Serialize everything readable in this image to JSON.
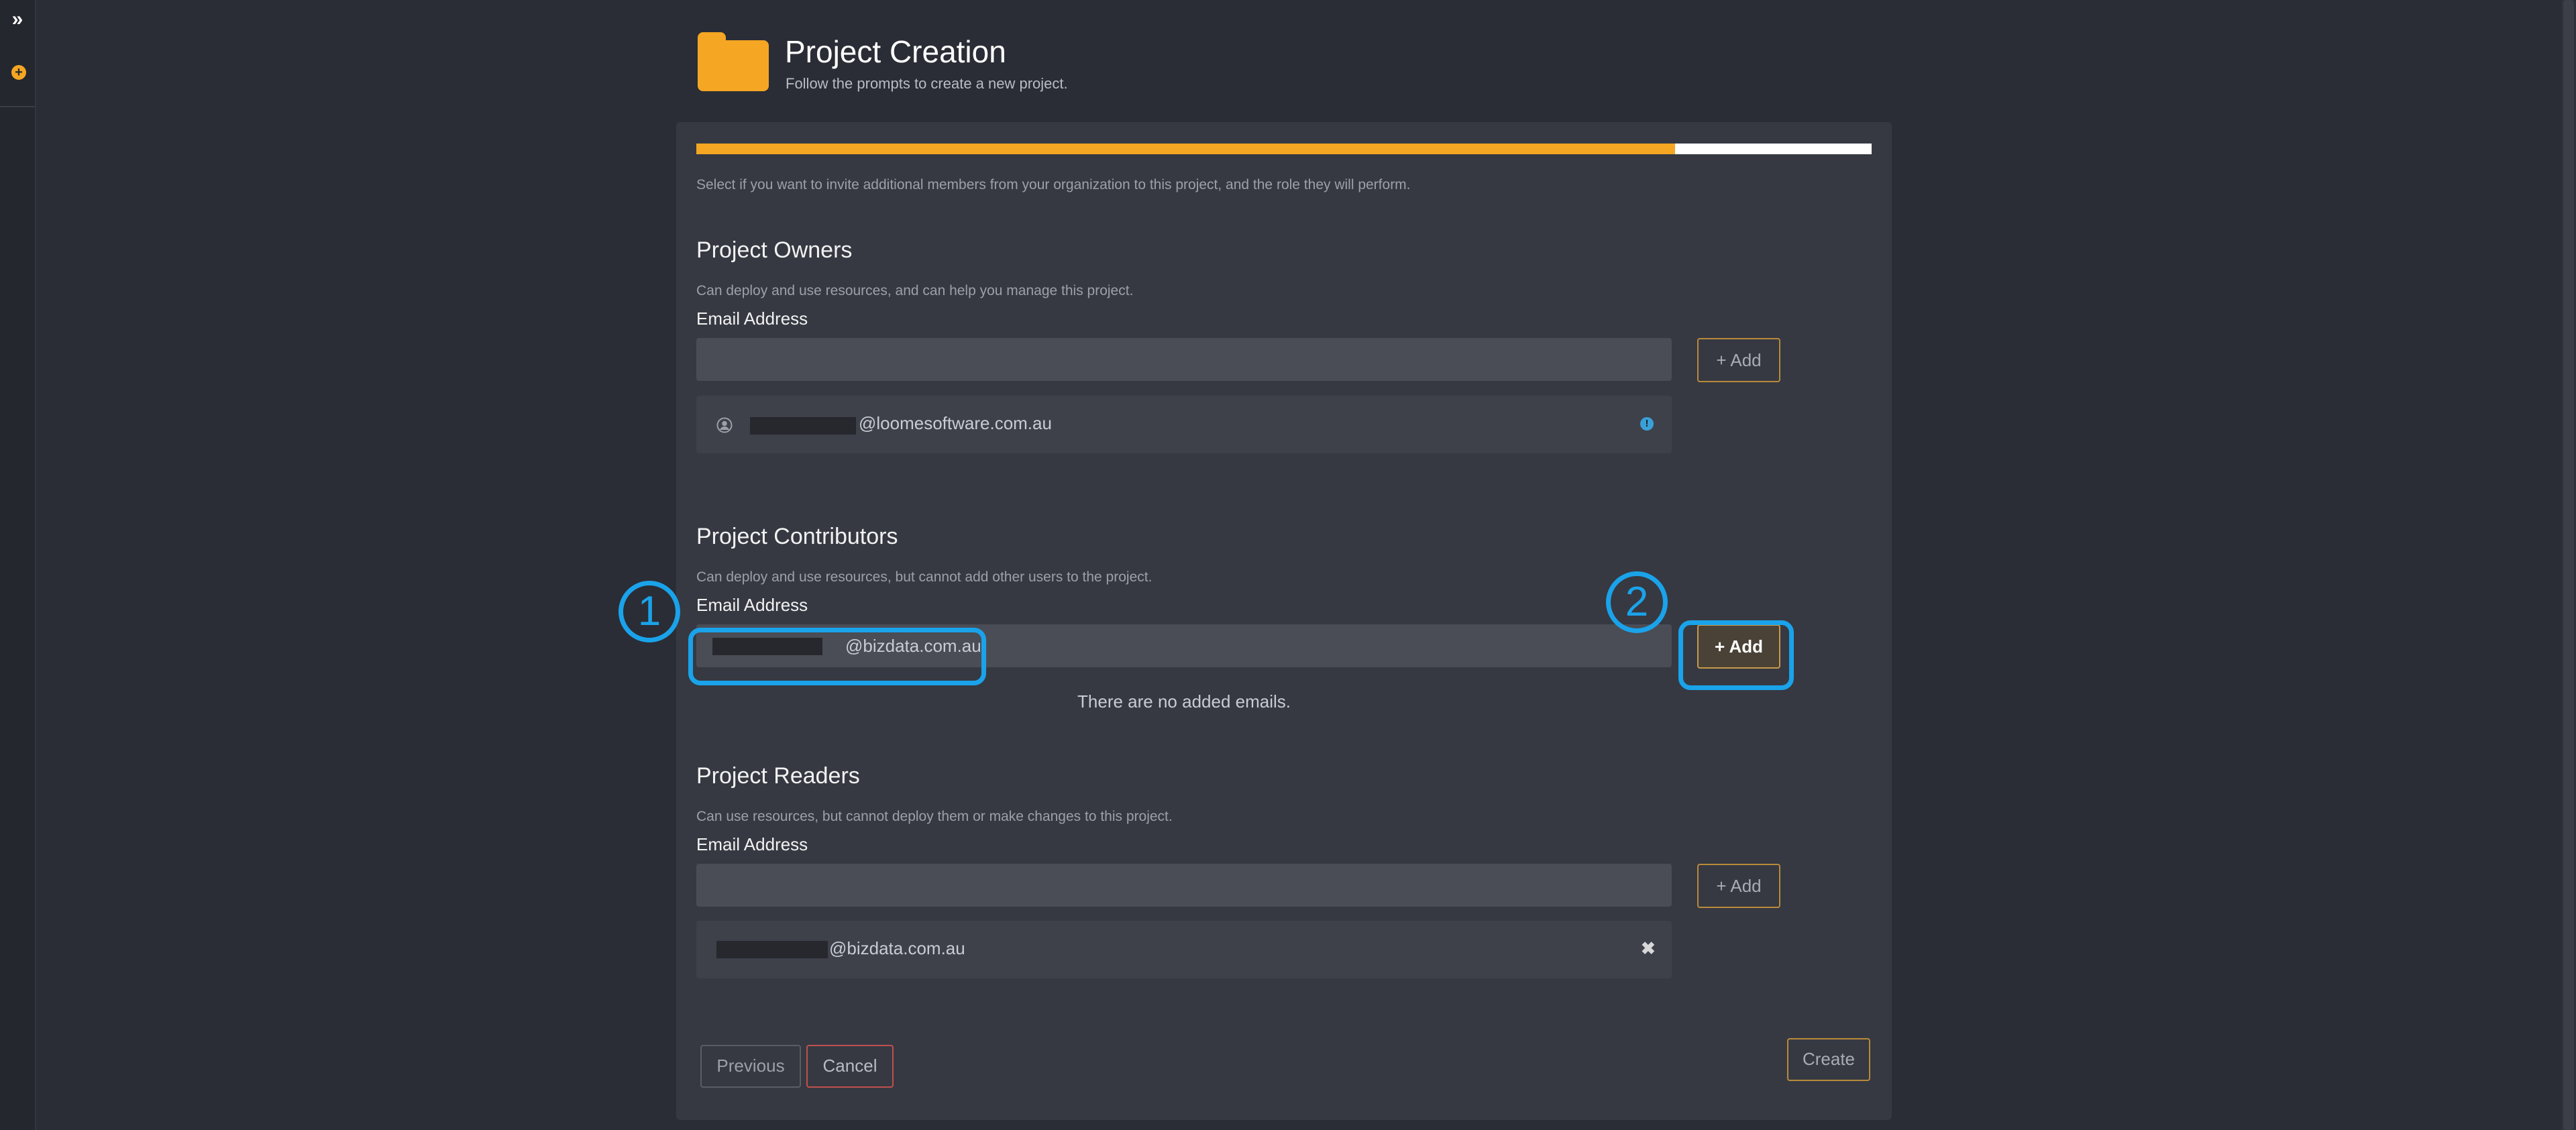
{
  "header": {
    "title": "Project Creation",
    "subtitle": "Follow the prompts to create a new project."
  },
  "progress": {
    "percent": 83.3
  },
  "intro": "Select if you want to invite additional members from your organization to this project, and the role they will perform.",
  "owners": {
    "title": "Project Owners",
    "description": "Can deploy and use resources, and can help you manage this project.",
    "label": "Email Address",
    "input_value": "",
    "add_label": "+ Add",
    "members": [
      {
        "email": "@loomesoftware.com.au"
      }
    ]
  },
  "contributors": {
    "title": "Project Contributors",
    "description": "Can deploy and use resources, but cannot add other users to the project.",
    "label": "Email Address",
    "input_value": "@bizdata.com.au",
    "add_label": "+ Add",
    "empty_message": "There are no added emails."
  },
  "readers": {
    "title": "Project Readers",
    "description": "Can use resources, but cannot deploy them or make changes to this project.",
    "label": "Email Address",
    "input_value": "",
    "add_label": "+ Add",
    "members": [
      {
        "email": "@bizdata.com.au"
      }
    ]
  },
  "footer": {
    "previous": "Previous",
    "cancel": "Cancel",
    "create": "Create"
  },
  "annotations": [
    {
      "number": "1"
    },
    {
      "number": "2"
    }
  ],
  "colors": {
    "accent": "#f5a623",
    "callout": "#1aa3ea",
    "danger": "#c0504d"
  },
  "icons": {
    "sidebar_expand": "double-chevron-right-icon",
    "sidebar_add": "plus-circle-icon",
    "header": "folder-icon",
    "owner_member": "user-circle-icon",
    "owner_info": "info-icon",
    "reader_remove": "close-icon"
  }
}
